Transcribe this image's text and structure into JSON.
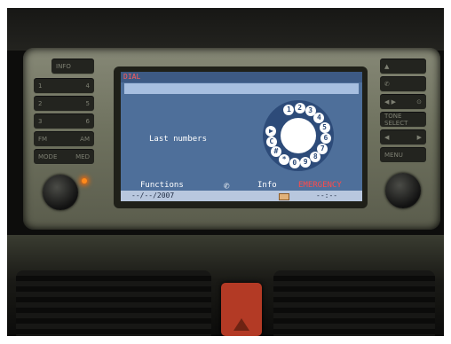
{
  "screen": {
    "title": "DIAL",
    "number_entry": "",
    "last_numbers_label": "Last numbers",
    "softkeys": {
      "functions": "Functions",
      "phone_icon": "phone-handset-icon",
      "info": "Info",
      "emergency": "EMERGENCY"
    },
    "status": {
      "date": "--/--/2007",
      "envelope_icon": "envelope-icon",
      "time": "--:--"
    },
    "dial_digits": [
      "1",
      "2",
      "3",
      "4",
      "5",
      "6",
      "7",
      "8",
      "9",
      "0",
      "*",
      "#",
      "C",
      "▶"
    ],
    "colors": {
      "screen_bg": "#4e6f9a",
      "title_text": "#ff5b5b",
      "emergency_text": "#ff4b4b",
      "status_bg": "#b8c7de"
    }
  },
  "console": {
    "left_buttons": [
      {
        "label": "INFO"
      },
      {
        "label": "1",
        "label2": "4"
      },
      {
        "label": "2",
        "label2": "5"
      },
      {
        "label": "3",
        "label2": "6"
      },
      {
        "label": "FM",
        "label2": "AM"
      },
      {
        "label": "MODE",
        "label2": "MED"
      }
    ],
    "right_buttons": [
      {
        "label": "▲"
      },
      {
        "label": "phone-handset-icon"
      },
      {
        "label": "◀ ▶",
        "label2": "⊙"
      },
      {
        "label": "TONE SELECT"
      },
      {
        "label": "◀",
        "label2": "▶"
      },
      {
        "label": "MENU"
      }
    ]
  }
}
